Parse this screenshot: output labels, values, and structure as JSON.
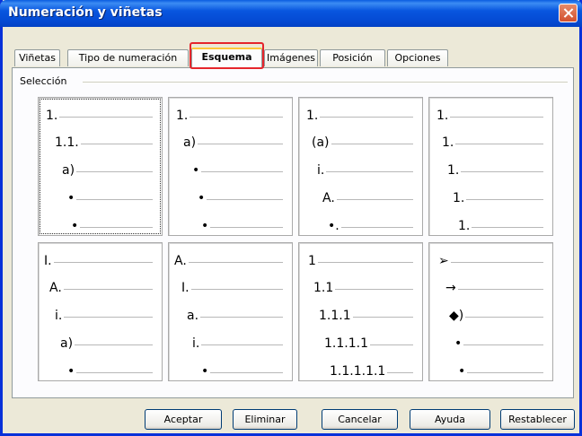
{
  "window": {
    "title": "Numeración y viñetas"
  },
  "tabs": [
    {
      "label": "Viñetas"
    },
    {
      "label": "Tipo de numeración"
    },
    {
      "label": "Esquema"
    },
    {
      "label": "Imágenes"
    },
    {
      "label": "Posición"
    },
    {
      "label": "Opciones"
    }
  ],
  "active_tab": "Esquema",
  "section": {
    "label": "Selección"
  },
  "outlines": [
    [
      "1.",
      "1.1.",
      "a)",
      "•",
      "•"
    ],
    [
      "1.",
      "a)",
      "•",
      "•",
      "•"
    ],
    [
      "1.",
      "(a)",
      "i.",
      "A.",
      "•."
    ],
    [
      "1.",
      "1.",
      "1.",
      "1.",
      "1."
    ],
    [
      "I.",
      "A.",
      "i.",
      "a)",
      "•"
    ],
    [
      "A.",
      "I.",
      "a.",
      "i.",
      "•"
    ],
    [
      "1",
      "1.1",
      "1.1.1",
      "1.1.1.1",
      "1.1.1.1.1"
    ],
    [
      "➢",
      "→",
      "◆)",
      "•",
      "•"
    ]
  ],
  "buttons": {
    "ok": "Aceptar",
    "delete": "Eliminar",
    "cancel": "Cancelar",
    "help": "Ayuda",
    "reset": "Restablecer"
  },
  "colors": {
    "titlebar": "#0054E3",
    "highlight": "#E5252C",
    "active_tab_accent": "#FFC83C"
  }
}
